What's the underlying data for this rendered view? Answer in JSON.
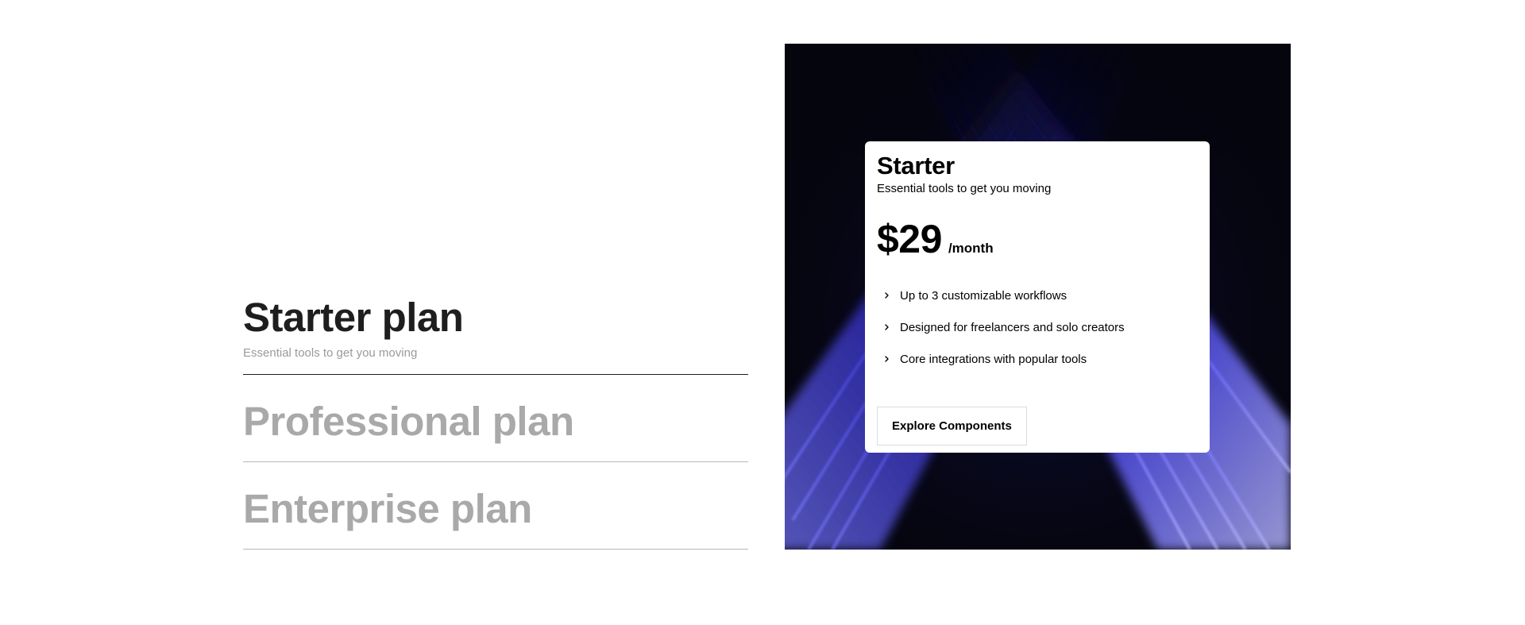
{
  "plans": [
    {
      "title": "Starter plan",
      "subtitle": "Essential tools to get you moving",
      "active": true
    },
    {
      "title": "Professional plan",
      "active": false
    },
    {
      "title": "Enterprise plan",
      "active": false
    }
  ],
  "card": {
    "title": "Starter",
    "subtitle": "Essential tools to get you moving",
    "price": "$29",
    "period": "/month",
    "features": [
      "Up to 3 customizable workflows",
      "Designed for freelancers and solo creators",
      "Core integrations with popular tools"
    ],
    "cta_label": "Explore Components"
  },
  "colors": {
    "active_text": "#1e1e1e",
    "inactive_text": "#a9a9a9",
    "panel_bg": "#05050f",
    "beam_accent": "#4a47ff"
  },
  "icons": {
    "feature_bullet": "chevron-right-icon"
  }
}
